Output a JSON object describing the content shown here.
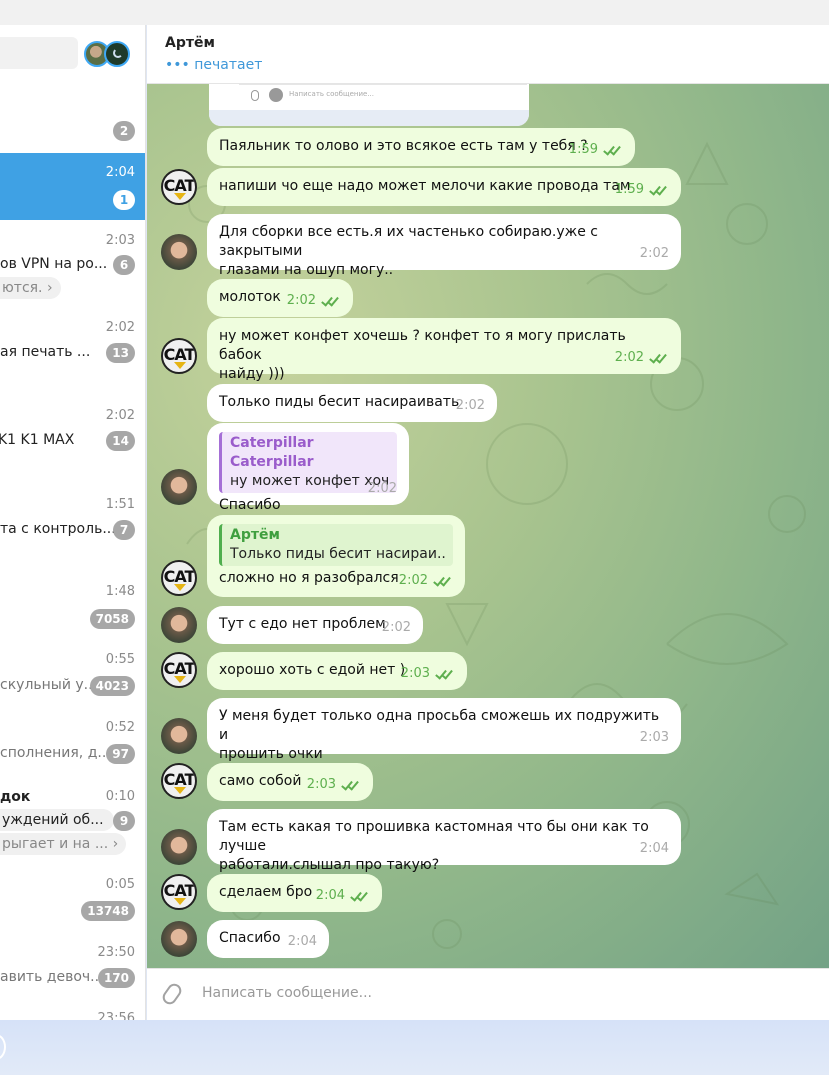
{
  "left_panel": {
    "rows": [
      {
        "time": "",
        "text": "",
        "badge": "2"
      },
      {
        "time": "2:04",
        "text": "",
        "badge": "1"
      },
      {
        "time": "2:03",
        "text": "ов  VPN на ро...",
        "badge": "6",
        "pill": "ются."
      },
      {
        "time": "2:02",
        "text": "ая печать  ...",
        "badge": "13"
      },
      {
        "time": "2:02",
        "text": "K1   K1 MAX",
        "badge": "14"
      },
      {
        "time": "1:51",
        "text": "та с контроль...",
        "badge": "7"
      },
      {
        "time": "1:48",
        "text": "",
        "badge": "7058"
      },
      {
        "time": "0:55",
        "text": "скульный у...",
        "badge": "4023"
      },
      {
        "time": "0:52",
        "text": "сполнения, д...",
        "badge": "97"
      },
      {
        "time": "0:10",
        "text": "док",
        "badge": "9",
        "pill": "уждений об...",
        "text2": "рыгает и на ..."
      },
      {
        "time": "0:05",
        "text": "",
        "badge": "13748"
      },
      {
        "time": "23:50",
        "text": "авить девоч...",
        "badge": "170"
      },
      {
        "time": "23:56",
        "text": "",
        "badge": ""
      }
    ]
  },
  "header": {
    "title": "Артём",
    "status": "••• печатает"
  },
  "previous_snippet": {
    "placeholder": "Написать сообщение..."
  },
  "messages": [
    {
      "dir": "out",
      "text": "Паяльник то олово и это всякое есть там у тебя ?",
      "time": "1:59",
      "read": true
    },
    {
      "dir": "out",
      "text": "напиши чо еще надо может мелочи какие провода там",
      "time": "1:59",
      "read": true
    },
    {
      "dir": "in",
      "text": "Для сборки все есть.я их частенько собираю.уже с закрытыми\nглазами на ошуп могу..",
      "time": "2:02"
    },
    {
      "dir": "out",
      "text": "молоток",
      "time": "2:02",
      "read": true
    },
    {
      "dir": "out",
      "text": "ну может конфет хочешь ? конфет то я могу прислать бабок\nнайду )))",
      "time": "2:02",
      "read": true
    },
    {
      "dir": "in",
      "text": "Только пиды бесит насираивать",
      "time": "2:02"
    },
    {
      "dir": "in",
      "text": "Спасибо",
      "time": "2:02",
      "reply_name": "Caterpillar Caterpillar",
      "reply_text": "ну может конфет хоч..."
    },
    {
      "dir": "out",
      "text": "сложно но я разобрался",
      "time": "2:02",
      "read": true,
      "reply_name": "Артём",
      "reply_text": "Только пиды бесит насираи..."
    },
    {
      "dir": "in",
      "text": "Тут с едо нет проблем",
      "time": "2:02"
    },
    {
      "dir": "out",
      "text": "хорошо хоть с едой нет )",
      "time": "2:03",
      "read": true
    },
    {
      "dir": "in",
      "text": "У меня будет только одна просьба сможешь их подружить и\nпрошить очки",
      "time": "2:03"
    },
    {
      "dir": "out",
      "text": "само собой",
      "time": "2:03",
      "read": true
    },
    {
      "dir": "in",
      "text": "Там есть какая то прошивка кастомная что бы они как то лучше\nработали.слышал про такую?",
      "time": "2:04"
    },
    {
      "dir": "out",
      "text": "сделаем бро",
      "time": "2:04",
      "read": true
    },
    {
      "dir": "in",
      "text": "Спасибо",
      "time": "2:04"
    }
  ],
  "avatars": {
    "cat_label": "CAT"
  },
  "composer": {
    "placeholder": "Написать сообщение..."
  },
  "colors": {
    "accent": "#3fa1e4",
    "outgoing_bubble": "#effdde",
    "incoming_bubble": "#ffffff",
    "read_ticks": "#5eaf4e"
  }
}
